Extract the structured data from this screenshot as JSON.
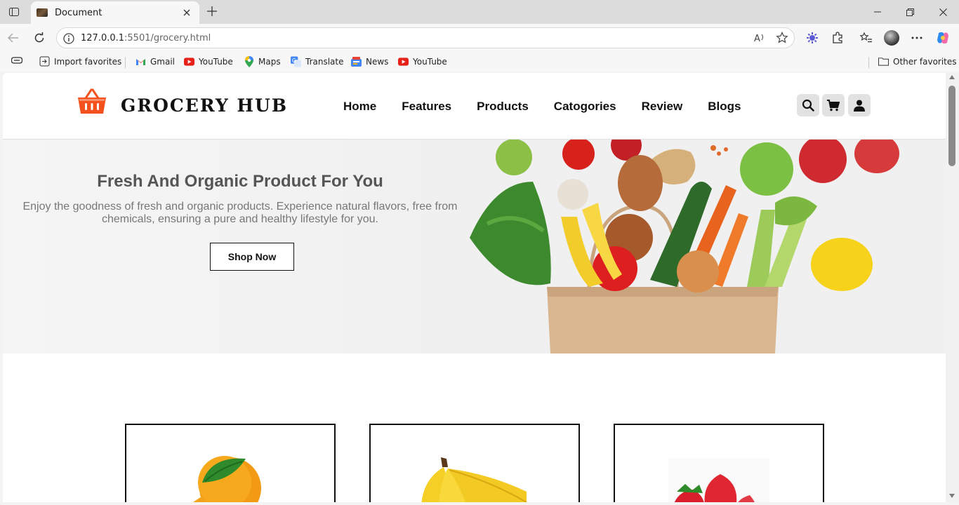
{
  "browser": {
    "tab_title": "Document",
    "url_host": "127.0.0.1",
    "url_rest": ":5501/grocery.html",
    "bookmarks": [
      {
        "label": "Import favorites",
        "icon": "import-icon"
      },
      {
        "label": "Gmail",
        "icon": "gmail-icon"
      },
      {
        "label": "YouTube",
        "icon": "youtube-icon"
      },
      {
        "label": "Maps",
        "icon": "maps-icon"
      },
      {
        "label": "Translate",
        "icon": "translate-icon"
      },
      {
        "label": "News",
        "icon": "news-icon"
      },
      {
        "label": "YouTube",
        "icon": "youtube-icon"
      }
    ],
    "other_favorites": "Other favorites"
  },
  "site": {
    "logo_text": "GROCERY HUB",
    "nav": [
      "Home",
      "Features",
      "Products",
      "Catogories",
      "Review",
      "Blogs"
    ],
    "accent_color": "#f4511e"
  },
  "hero": {
    "title": "Fresh And Organic Product For You",
    "description": "Enjoy the goodness of fresh and organic products. Experience natural flavors, free from chemicals, ensuring a pure and healthy lifestyle for you.",
    "button": "Shop Now"
  },
  "cards": [
    {
      "image": "orange"
    },
    {
      "image": "banana"
    },
    {
      "image": "strawberry"
    }
  ]
}
